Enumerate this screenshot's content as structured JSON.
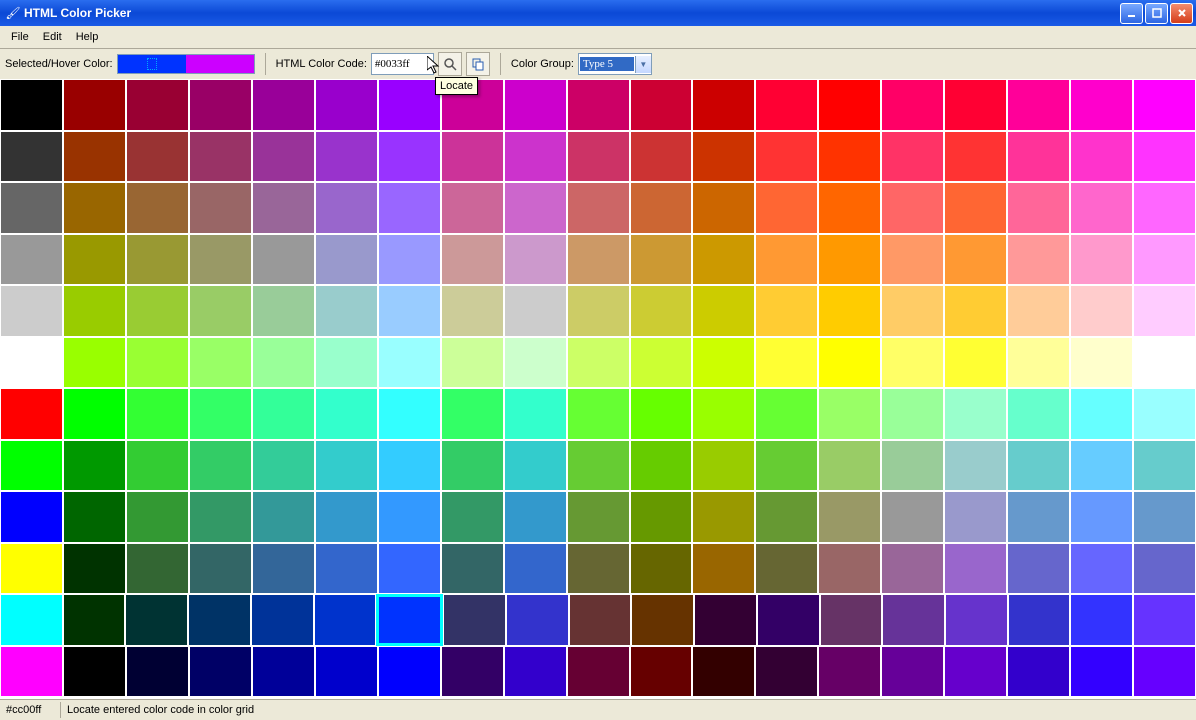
{
  "window": {
    "title": "HTML Color Picker"
  },
  "menu": {
    "file": "File",
    "edit": "Edit",
    "help": "Help"
  },
  "toolbar": {
    "selected_label": "Selected/Hover Color:",
    "code_label": "HTML Color Code:",
    "code_value": "#0033ff",
    "group_label": "Color Group:",
    "group_value": "Type 5",
    "tooltip": "Locate",
    "selected_color": "#0033ff",
    "hover_color": "#cc00ff"
  },
  "status": {
    "left": "#cc00ff",
    "right": "Locate entered color code in color grid"
  },
  "palette": {
    "selected_index": [
      10,
      6
    ],
    "rows": [
      [
        "#000000",
        "#990000",
        "#990033",
        "#990066",
        "#990099",
        "#9900cc",
        "#9900ff",
        "#cc0099",
        "#cc00cc",
        "#cc0066",
        "#cc0033",
        "#cc0000",
        "#ff0033",
        "#ff0000",
        "#ff0066",
        "#ff0033",
        "#ff0099",
        "#ff00cc",
        "#ff00ff"
      ],
      [
        "#333333",
        "#993300",
        "#993333",
        "#993366",
        "#993399",
        "#9933cc",
        "#9933ff",
        "#cc3399",
        "#cc33cc",
        "#cc3366",
        "#cc3333",
        "#cc3300",
        "#ff3333",
        "#ff3300",
        "#ff3366",
        "#ff3333",
        "#ff3399",
        "#ff33cc",
        "#ff33ff"
      ],
      [
        "#666666",
        "#996600",
        "#996633",
        "#996666",
        "#996699",
        "#9966cc",
        "#9966ff",
        "#cc6699",
        "#cc66cc",
        "#cc6666",
        "#cc6633",
        "#cc6600",
        "#ff6633",
        "#ff6600",
        "#ff6666",
        "#ff6633",
        "#ff6699",
        "#ff66cc",
        "#ff66ff"
      ],
      [
        "#999999",
        "#999900",
        "#999933",
        "#999966",
        "#999999",
        "#9999cc",
        "#9999ff",
        "#cc9999",
        "#cc99cc",
        "#cc9966",
        "#cc9933",
        "#cc9900",
        "#ff9933",
        "#ff9900",
        "#ff9966",
        "#ff9933",
        "#ff9999",
        "#ff99cc",
        "#ff99ff"
      ],
      [
        "#cccccc",
        "#99cc00",
        "#99cc33",
        "#99cc66",
        "#99cc99",
        "#99cccc",
        "#99ccff",
        "#cccc99",
        "#cccccc",
        "#cccc66",
        "#cccc33",
        "#cccc00",
        "#ffcc33",
        "#ffcc00",
        "#ffcc66",
        "#ffcc33",
        "#ffcc99",
        "#ffcccc",
        "#ffccff"
      ],
      [
        "#ffffff",
        "#99ff00",
        "#99ff33",
        "#99ff66",
        "#99ff99",
        "#99ffcc",
        "#99ffff",
        "#ccff99",
        "#ccffcc",
        "#ccff66",
        "#ccff33",
        "#ccff00",
        "#ffff33",
        "#ffff00",
        "#ffff66",
        "#ffff33",
        "#ffff99",
        "#ffffcc",
        "#ffffff"
      ],
      [
        "#ff0000",
        "#00ff00",
        "#33ff33",
        "#33ff66",
        "#33ff99",
        "#33ffcc",
        "#33ffff",
        "#33ff66",
        "#33ffcc",
        "#66ff33",
        "#66ff00",
        "#99ff00",
        "#66ff33",
        "#99ff66",
        "#99ff99",
        "#99ffcc",
        "#66ffcc",
        "#66ffff",
        "#99ffff"
      ],
      [
        "#00ff00",
        "#009900",
        "#33cc33",
        "#33cc66",
        "#33cc99",
        "#33cccc",
        "#33ccff",
        "#33cc66",
        "#33cccc",
        "#66cc33",
        "#66cc00",
        "#99cc00",
        "#66cc33",
        "#99cc66",
        "#99cc99",
        "#99cccc",
        "#66cccc",
        "#66ccff",
        "#66cccc"
      ],
      [
        "#0000ff",
        "#006600",
        "#339933",
        "#339966",
        "#339999",
        "#3399cc",
        "#3399ff",
        "#339966",
        "#3399cc",
        "#669933",
        "#669900",
        "#999900",
        "#669933",
        "#999966",
        "#999999",
        "#9999cc",
        "#6699cc",
        "#6699ff",
        "#6699cc"
      ],
      [
        "#ffff00",
        "#003300",
        "#336633",
        "#336666",
        "#336699",
        "#3366cc",
        "#3366ff",
        "#336666",
        "#3366cc",
        "#666633",
        "#666600",
        "#996600",
        "#666633",
        "#996666",
        "#996699",
        "#9966cc",
        "#6666cc",
        "#6666ff",
        "#6666cc"
      ],
      [
        "#00ffff",
        "#003300",
        "#003333",
        "#003366",
        "#003399",
        "#0033cc",
        "#0033ff",
        "#333366",
        "#3333cc",
        "#663333",
        "#663300",
        "#330033",
        "#330066",
        "#663366",
        "#663399",
        "#6633cc",
        "#3333cc",
        "#3333ff",
        "#6633ff"
      ],
      [
        "#ff00ff",
        "#000000",
        "#000033",
        "#000066",
        "#000099",
        "#0000cc",
        "#0000ff",
        "#330066",
        "#3300cc",
        "#660033",
        "#660000",
        "#330000",
        "#330033",
        "#660066",
        "#660099",
        "#6600cc",
        "#3300cc",
        "#3300ff",
        "#6600ff"
      ]
    ]
  }
}
